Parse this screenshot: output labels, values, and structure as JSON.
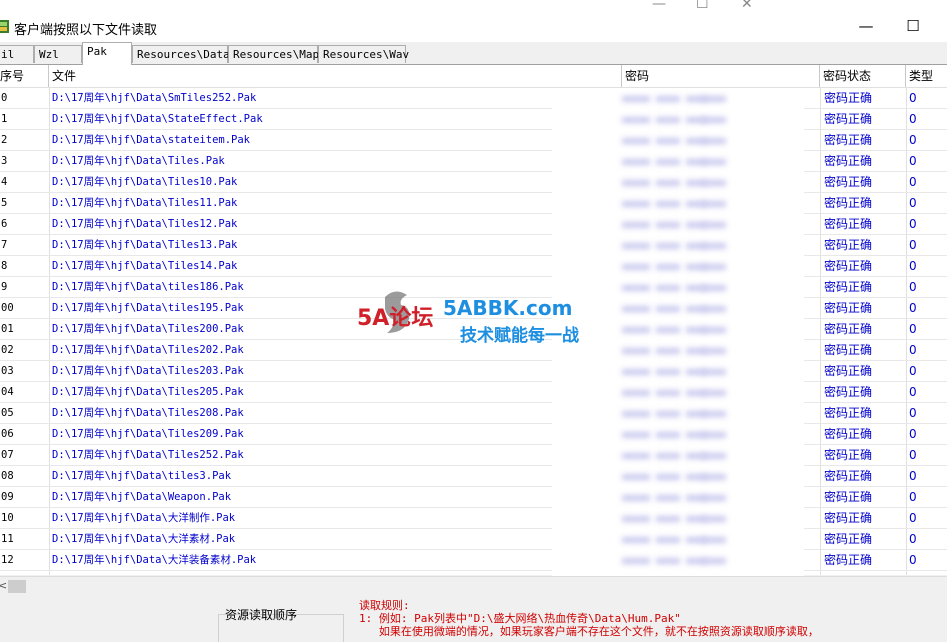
{
  "window": {
    "title": "客户端按照以下文件读取",
    "minimize": "—",
    "maximize": "☐",
    "close": "✕"
  },
  "background_window": {
    "controls": [
      "—",
      "☐",
      "✕"
    ]
  },
  "tabs": [
    {
      "label": "il"
    },
    {
      "label": "Wzl"
    },
    {
      "label": "Pak",
      "active": true
    },
    {
      "label": "Resources\\Data"
    },
    {
      "label": "Resources\\Map"
    },
    {
      "label": "Resources\\Wav"
    }
  ],
  "columns": {
    "index": "序号",
    "file": "文件",
    "password": "密码",
    "password_status": "密码状态",
    "type": "类型"
  },
  "rows": [
    {
      "index": "0",
      "file": "D:\\17周年\\hjf\\Data\\SmTiles252.Pak",
      "status": "密码正确",
      "type": "0"
    },
    {
      "index": "1",
      "file": "D:\\17周年\\hjf\\Data\\StateEffect.Pak",
      "status": "密码正确",
      "type": "0"
    },
    {
      "index": "2",
      "file": "D:\\17周年\\hjf\\Data\\stateitem.Pak",
      "status": "密码正确",
      "type": "0"
    },
    {
      "index": "3",
      "file": "D:\\17周年\\hjf\\Data\\Tiles.Pak",
      "status": "密码正确",
      "type": "0"
    },
    {
      "index": "4",
      "file": "D:\\17周年\\hjf\\Data\\Tiles10.Pak",
      "status": "密码正确",
      "type": "0"
    },
    {
      "index": "5",
      "file": "D:\\17周年\\hjf\\Data\\Tiles11.Pak",
      "status": "密码正确",
      "type": "0"
    },
    {
      "index": "6",
      "file": "D:\\17周年\\hjf\\Data\\Tiles12.Pak",
      "status": "密码正确",
      "type": "0"
    },
    {
      "index": "7",
      "file": "D:\\17周年\\hjf\\Data\\Tiles13.Pak",
      "status": "密码正确",
      "type": "0"
    },
    {
      "index": "8",
      "file": "D:\\17周年\\hjf\\Data\\Tiles14.Pak",
      "status": "密码正确",
      "type": "0"
    },
    {
      "index": "9",
      "file": "D:\\17周年\\hjf\\Data\\tiles186.Pak",
      "status": "密码正确",
      "type": "0"
    },
    {
      "index": "00",
      "file": "D:\\17周年\\hjf\\Data\\tiles195.Pak",
      "status": "密码正确",
      "type": "0"
    },
    {
      "index": "01",
      "file": "D:\\17周年\\hjf\\Data\\Tiles200.Pak",
      "status": "密码正确",
      "type": "0"
    },
    {
      "index": "02",
      "file": "D:\\17周年\\hjf\\Data\\Tiles202.Pak",
      "status": "密码正确",
      "type": "0"
    },
    {
      "index": "03",
      "file": "D:\\17周年\\hjf\\Data\\Tiles203.Pak",
      "status": "密码正确",
      "type": "0"
    },
    {
      "index": "04",
      "file": "D:\\17周年\\hjf\\Data\\Tiles205.Pak",
      "status": "密码正确",
      "type": "0"
    },
    {
      "index": "05",
      "file": "D:\\17周年\\hjf\\Data\\Tiles208.Pak",
      "status": "密码正确",
      "type": "0"
    },
    {
      "index": "06",
      "file": "D:\\17周年\\hjf\\Data\\Tiles209.Pak",
      "status": "密码正确",
      "type": "0"
    },
    {
      "index": "07",
      "file": "D:\\17周年\\hjf\\Data\\Tiles252.Pak",
      "status": "密码正确",
      "type": "0"
    },
    {
      "index": "08",
      "file": "D:\\17周年\\hjf\\Data\\tiles3.Pak",
      "status": "密码正确",
      "type": "0"
    },
    {
      "index": "09",
      "file": "D:\\17周年\\hjf\\Data\\Weapon.Pak",
      "status": "密码正确",
      "type": "0"
    },
    {
      "index": "10",
      "file": "D:\\17周年\\hjf\\Data\\大洋制作.Pak",
      "status": "密码正确",
      "type": "0"
    },
    {
      "index": "11",
      "file": "D:\\17周年\\hjf\\Data\\大洋素材.Pak",
      "status": "密码正确",
      "type": "0"
    },
    {
      "index": "12",
      "file": "D:\\17周年\\hjf\\Data\\大洋装备素材.Pak",
      "status": "密码正确",
      "type": "0"
    }
  ],
  "bottom": {
    "order_label": "资源读取顺序",
    "rules_title": "读取规则:",
    "rules_line1": "1: 例如: Pak列表中\"D:\\盛大网络\\热血传奇\\Data\\Hum.Pak\"",
    "rules_line2": "   如果在使用微端的情况，如果玩家客户端不存在这个文件，就不在按照资源读取顺序读取，"
  },
  "watermark": {
    "logo_text": "5A论坛",
    "site": "5ABBK.com",
    "slogan": "技术赋能每一战"
  },
  "colors": {
    "status_text": "#0000cc",
    "rules_text": "#d00000",
    "watermark_blue": "#1e8fe0",
    "watermark_red": "#d0202a"
  }
}
